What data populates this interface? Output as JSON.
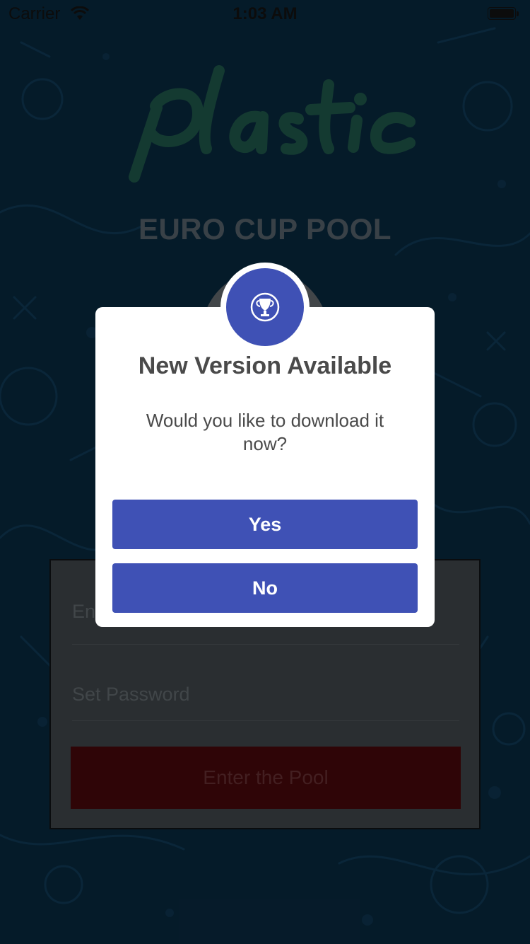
{
  "status_bar": {
    "carrier": "Carrier",
    "time": "1:03 AM"
  },
  "app": {
    "title": "EURO CUP POOL",
    "logo_icon": "plastic-logo"
  },
  "login": {
    "email_placeholder": "Enter Email",
    "password_placeholder": "Set Password",
    "enter_button": "Enter the Pool"
  },
  "alert": {
    "icon": "trophy-icon",
    "title": "New Version Available",
    "message": "Would you like to download it now?",
    "yes_label": "Yes",
    "no_label": "No"
  },
  "colors": {
    "background": "#08263a",
    "logo_green": "#1c5145",
    "alert_accent": "#3f51b5",
    "enter_button": "#42070a"
  }
}
